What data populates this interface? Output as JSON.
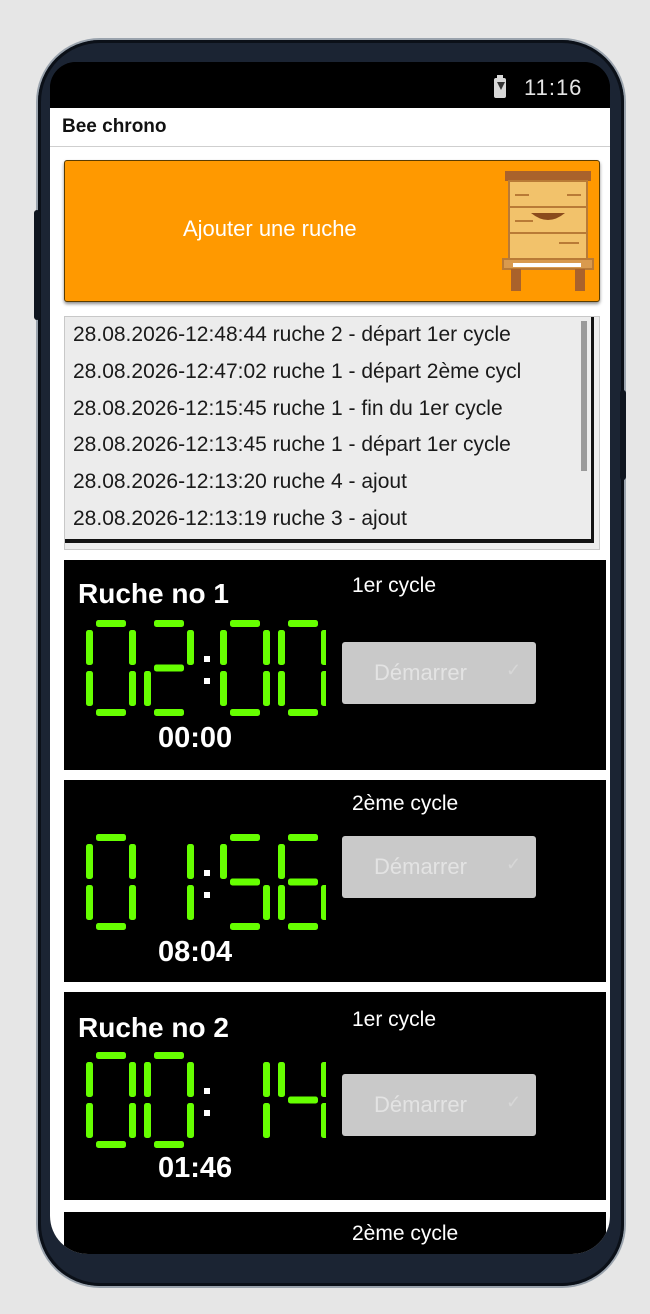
{
  "status_bar": {
    "time": "11:16"
  },
  "app": {
    "title": "Bee chrono"
  },
  "add_button": {
    "label": "Ajouter une ruche"
  },
  "log": [
    "28.08.2026-12:48:44 ruche 2 - départ 1er cycle",
    "28.08.2026-12:47:02 ruche 1 - départ 2ème cycl",
    "28.08.2026-12:15:45 ruche 1 - fin du 1er cycle",
    "28.08.2026-12:13:45 ruche 1 - départ 1er cycle",
    "28.08.2026-12:13:20 ruche 4 - ajout",
    "28.08.2026-12:13:19 ruche 3 - ajout"
  ],
  "hives": [
    {
      "title": "Ruche no 1",
      "cycles": [
        {
          "label": "1er cycle",
          "display": "02:00",
          "elapsed": "00:00",
          "button": "Démarrer"
        },
        {
          "label": "2ème cycle",
          "display": "01:56",
          "elapsed": "08:04",
          "button": "Démarrer"
        }
      ]
    },
    {
      "title": "Ruche no 2",
      "cycles": [
        {
          "label": "1er cycle",
          "display": "00:14",
          "elapsed": "01:46",
          "button": "Démarrer"
        },
        {
          "label": "2ème cycle",
          "display": "",
          "elapsed": "",
          "button": ""
        }
      ]
    }
  ],
  "colors": {
    "accent": "#ff9900",
    "segment": "#66ff00",
    "button_disabled": "#c9c9c9"
  },
  "icons": {
    "battery": "battery-charging-icon",
    "hive": "beehive-icon",
    "check": "check-icon"
  }
}
